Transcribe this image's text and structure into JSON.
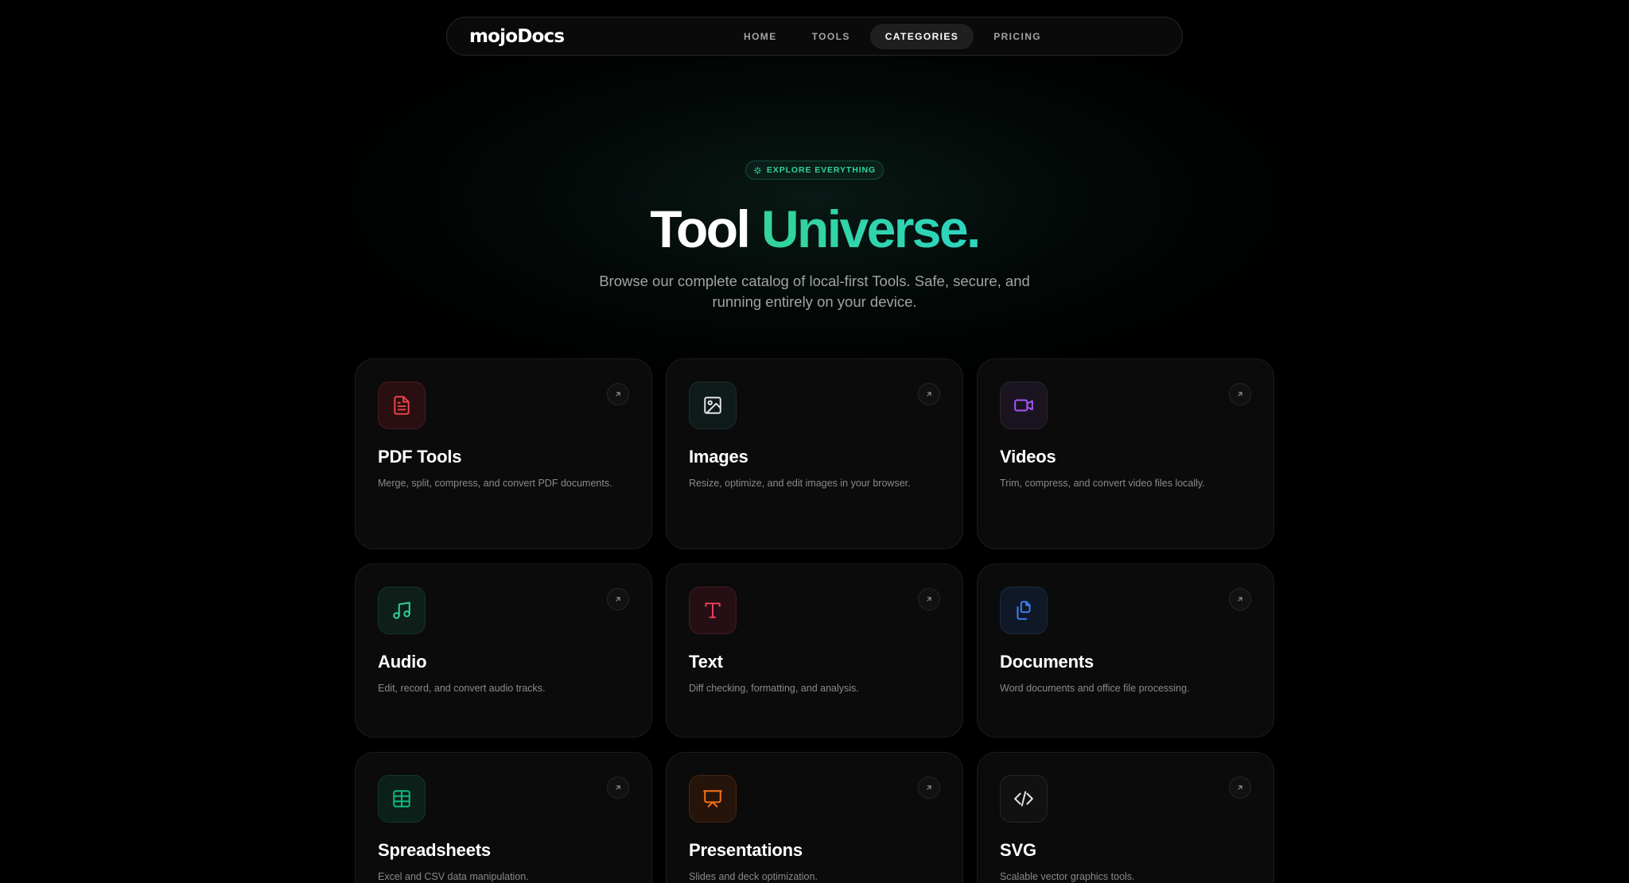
{
  "nav": {
    "logo": "mojoDocs",
    "links": [
      "HOME",
      "TOOLS",
      "CATEGORIES",
      "PRICING"
    ],
    "active": "CATEGORIES"
  },
  "hero": {
    "badge": "EXPLORE EVERYTHING",
    "badge_icon": "sparkle-icon",
    "title_white": "Tool",
    "title_accent": "Universe.",
    "subtitle": "Browse our complete catalog of local-first Tools. Safe, secure, and running entirely on your device."
  },
  "colors": {
    "accent": "#34d399",
    "background": "#000000",
    "card_bg": "#0b0b0b"
  },
  "categories": [
    {
      "title": "PDF Tools",
      "desc": "Merge, split, compress, and convert PDF documents.",
      "icon": "file-text-icon",
      "color": "#ef4444"
    },
    {
      "title": "Images",
      "desc": "Resize, optimize, and edit images in your browser.",
      "icon": "image-icon",
      "color": "#e5e5e5"
    },
    {
      "title": "Videos",
      "desc": "Trim, compress, and convert video files locally.",
      "icon": "video-icon",
      "color": "#a855f7"
    },
    {
      "title": "Audio",
      "desc": "Edit, record, and convert audio tracks.",
      "icon": "music-icon",
      "color": "#34d399"
    },
    {
      "title": "Text",
      "desc": "Diff checking, formatting, and analysis.",
      "icon": "type-icon",
      "color": "#f43f5e"
    },
    {
      "title": "Documents",
      "desc": "Word documents and office file processing.",
      "icon": "files-icon",
      "color": "#3b82f6"
    },
    {
      "title": "Spreadsheets",
      "desc": "Excel and CSV data manipulation.",
      "icon": "table-icon",
      "color": "#10b981"
    },
    {
      "title": "Presentations",
      "desc": "Slides and deck optimization.",
      "icon": "presentation-icon",
      "color": "#f97316"
    },
    {
      "title": "SVG",
      "desc": "Scalable vector graphics tools.",
      "icon": "code-icon",
      "color": "#e5e5e5"
    }
  ]
}
